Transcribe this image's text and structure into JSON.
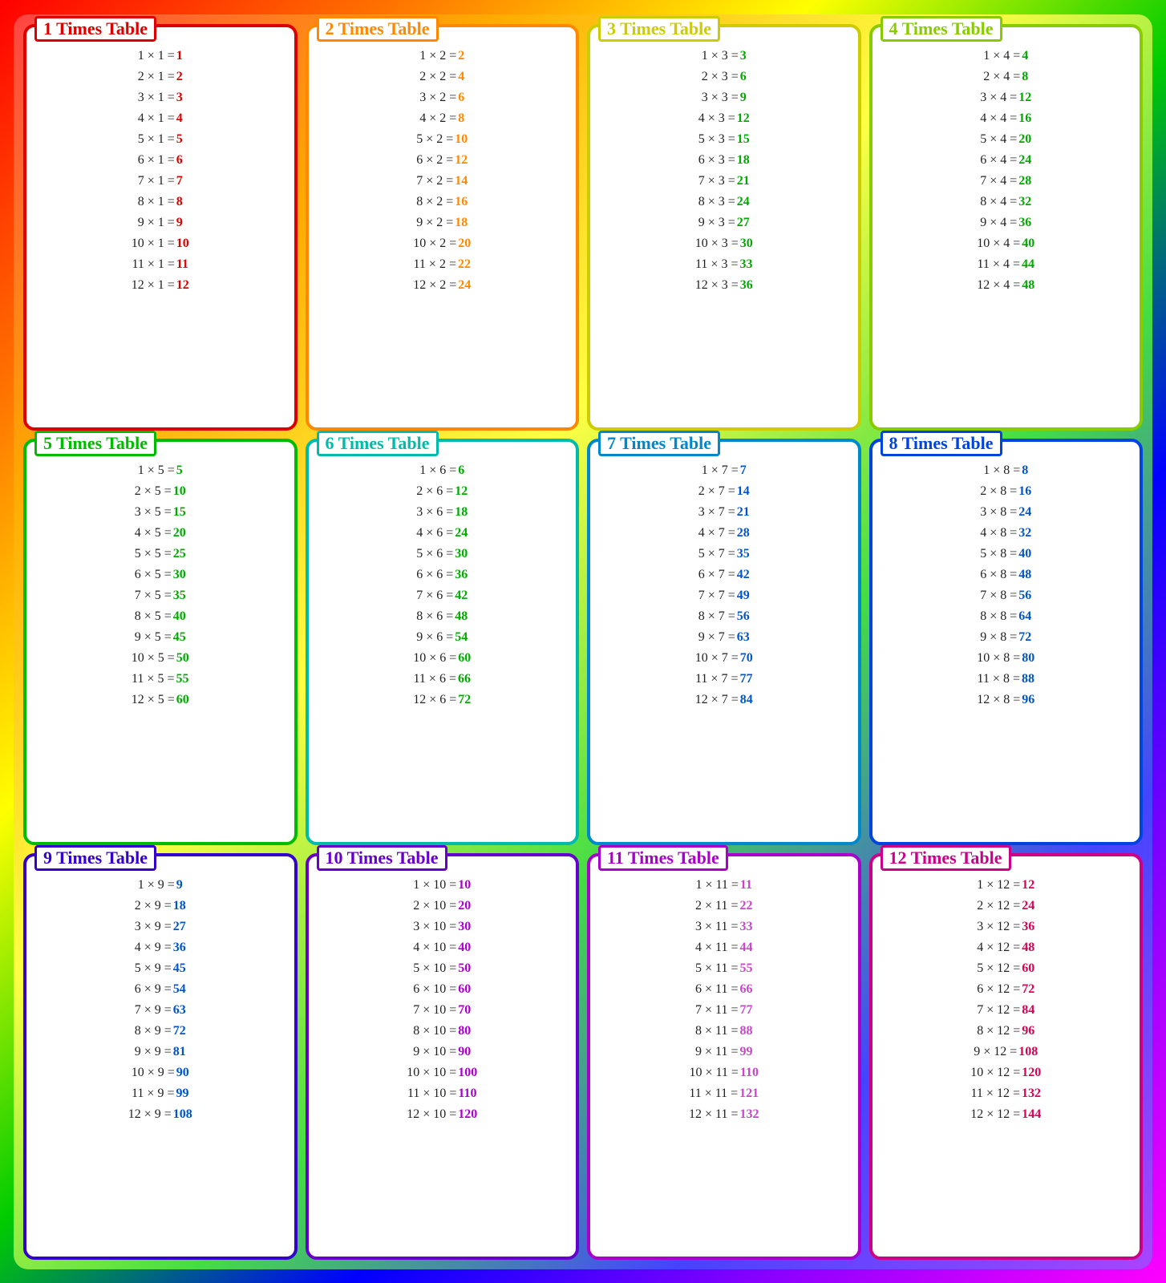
{
  "tables": [
    {
      "id": 1,
      "title": "1 Times Table",
      "multiplier": 1,
      "borderClass": "card-1",
      "resultClass": "c1",
      "rows": [
        {
          "eq": "1 × 1 = ",
          "result": "1"
        },
        {
          "eq": "2 × 1 = ",
          "result": "2"
        },
        {
          "eq": "3 × 1 = ",
          "result": "3"
        },
        {
          "eq": "4 × 1 = ",
          "result": "4"
        },
        {
          "eq": "5 × 1 = ",
          "result": "5"
        },
        {
          "eq": "6 × 1 = ",
          "result": "6"
        },
        {
          "eq": "7 × 1 = ",
          "result": "7"
        },
        {
          "eq": "8 × 1 = ",
          "result": "8"
        },
        {
          "eq": "9 × 1 = ",
          "result": "9"
        },
        {
          "eq": "10 × 1 = ",
          "result": "10"
        },
        {
          "eq": "11 × 1 = ",
          "result": "11"
        },
        {
          "eq": "12 × 1 = ",
          "result": "12"
        }
      ]
    },
    {
      "id": 2,
      "title": "2 Times Table",
      "borderClass": "card-2",
      "resultClass": "c2",
      "rows": [
        {
          "eq": "1 × 2 = ",
          "result": "2"
        },
        {
          "eq": "2 × 2 = ",
          "result": "4"
        },
        {
          "eq": "3 × 2 = ",
          "result": "6"
        },
        {
          "eq": "4 × 2 = ",
          "result": "8"
        },
        {
          "eq": "5 × 2 = ",
          "result": "10"
        },
        {
          "eq": "6 × 2 = ",
          "result": "12"
        },
        {
          "eq": "7 × 2 = ",
          "result": "14"
        },
        {
          "eq": "8 × 2 = ",
          "result": "16"
        },
        {
          "eq": "9 × 2 = ",
          "result": "18"
        },
        {
          "eq": "10 × 2 = ",
          "result": "20"
        },
        {
          "eq": "11 × 2 = ",
          "result": "22"
        },
        {
          "eq": "12 × 2 = ",
          "result": "24"
        }
      ]
    },
    {
      "id": 3,
      "title": "3 Times Table",
      "borderClass": "card-3",
      "resultClass": "c3",
      "rows": [
        {
          "eq": "1 × 3 = ",
          "result": "3"
        },
        {
          "eq": "2 × 3 = ",
          "result": "6"
        },
        {
          "eq": "3 × 3 = ",
          "result": "9"
        },
        {
          "eq": "4 × 3 = ",
          "result": "12"
        },
        {
          "eq": "5 × 3 = ",
          "result": "15"
        },
        {
          "eq": "6 × 3 = ",
          "result": "18"
        },
        {
          "eq": "7 × 3 = ",
          "result": "21"
        },
        {
          "eq": "8 × 3 = ",
          "result": "24"
        },
        {
          "eq": "9 × 3 = ",
          "result": "27"
        },
        {
          "eq": "10 × 3 = ",
          "result": "30"
        },
        {
          "eq": "11 × 3 = ",
          "result": "33"
        },
        {
          "eq": "12 × 3 = ",
          "result": "36"
        }
      ]
    },
    {
      "id": 4,
      "title": "4 Times Table",
      "borderClass": "card-4",
      "resultClass": "c4",
      "rows": [
        {
          "eq": "1 × 4 = ",
          "result": "4"
        },
        {
          "eq": "2 × 4 = ",
          "result": "8"
        },
        {
          "eq": "3 × 4 = ",
          "result": "12"
        },
        {
          "eq": "4 × 4 = ",
          "result": "16"
        },
        {
          "eq": "5 × 4 = ",
          "result": "20"
        },
        {
          "eq": "6 × 4 = ",
          "result": "24"
        },
        {
          "eq": "7 × 4 = ",
          "result": "28"
        },
        {
          "eq": "8 × 4 = ",
          "result": "32"
        },
        {
          "eq": "9 × 4 = ",
          "result": "36"
        },
        {
          "eq": "10 × 4 = ",
          "result": "40"
        },
        {
          "eq": "11 × 4 = ",
          "result": "44"
        },
        {
          "eq": "12 × 4 = ",
          "result": "48"
        }
      ]
    },
    {
      "id": 5,
      "title": "5 Times Table",
      "borderClass": "card-5",
      "resultClass": "c5",
      "rows": [
        {
          "eq": "1 × 5 = ",
          "result": "5"
        },
        {
          "eq": "2 × 5 = ",
          "result": "10"
        },
        {
          "eq": "3 × 5 = ",
          "result": "15"
        },
        {
          "eq": "4 × 5 = ",
          "result": "20"
        },
        {
          "eq": "5 × 5 = ",
          "result": "25"
        },
        {
          "eq": "6 × 5 = ",
          "result": "30"
        },
        {
          "eq": "7 × 5 = ",
          "result": "35"
        },
        {
          "eq": "8 × 5 = ",
          "result": "40"
        },
        {
          "eq": "9 × 5 = ",
          "result": "45"
        },
        {
          "eq": "10 × 5 = ",
          "result": "50"
        },
        {
          "eq": "11 × 5 = ",
          "result": "55"
        },
        {
          "eq": "12 × 5 = ",
          "result": "60"
        }
      ]
    },
    {
      "id": 6,
      "title": "6 Times Table",
      "borderClass": "card-6",
      "resultClass": "c6",
      "rows": [
        {
          "eq": "1 × 6 = ",
          "result": "6"
        },
        {
          "eq": "2 × 6 = ",
          "result": "12"
        },
        {
          "eq": "3 × 6 = ",
          "result": "18"
        },
        {
          "eq": "4 × 6 = ",
          "result": "24"
        },
        {
          "eq": "5 × 6 = ",
          "result": "30"
        },
        {
          "eq": "6 × 6 = ",
          "result": "36"
        },
        {
          "eq": "7 × 6 = ",
          "result": "42"
        },
        {
          "eq": "8 × 6 = ",
          "result": "48"
        },
        {
          "eq": "9 × 6 = ",
          "result": "54"
        },
        {
          "eq": "10 × 6 = ",
          "result": "60"
        },
        {
          "eq": "11 × 6 = ",
          "result": "66"
        },
        {
          "eq": "12 × 6 = ",
          "result": "72"
        }
      ]
    },
    {
      "id": 7,
      "title": "7 Times Table",
      "borderClass": "card-7",
      "resultClass": "c7",
      "rows": [
        {
          "eq": "1 × 7 = ",
          "result": "7"
        },
        {
          "eq": "2 × 7 = ",
          "result": "14"
        },
        {
          "eq": "3 × 7 = ",
          "result": "21"
        },
        {
          "eq": "4 × 7 = ",
          "result": "28"
        },
        {
          "eq": "5 × 7 = ",
          "result": "35"
        },
        {
          "eq": "6 × 7 = ",
          "result": "42"
        },
        {
          "eq": "7 × 7 = ",
          "result": "49"
        },
        {
          "eq": "8 × 7 = ",
          "result": "56"
        },
        {
          "eq": "9 × 7 = ",
          "result": "63"
        },
        {
          "eq": "10 × 7 = ",
          "result": "70"
        },
        {
          "eq": "11 × 7 = ",
          "result": "77"
        },
        {
          "eq": "12 × 7 = ",
          "result": "84"
        }
      ]
    },
    {
      "id": 8,
      "title": "8 Times Table",
      "borderClass": "card-8",
      "resultClass": "c8",
      "rows": [
        {
          "eq": "1 × 8 = ",
          "result": "8"
        },
        {
          "eq": "2 × 8 = ",
          "result": "16"
        },
        {
          "eq": "3 × 8 = ",
          "result": "24"
        },
        {
          "eq": "4 × 8 = ",
          "result": "32"
        },
        {
          "eq": "5 × 8 = ",
          "result": "40"
        },
        {
          "eq": "6 × 8 = ",
          "result": "48"
        },
        {
          "eq": "7 × 8 = ",
          "result": "56"
        },
        {
          "eq": "8 × 8 = ",
          "result": "64"
        },
        {
          "eq": "9 × 8 = ",
          "result": "72"
        },
        {
          "eq": "10 × 8 = ",
          "result": "80"
        },
        {
          "eq": "11 × 8 = ",
          "result": "88"
        },
        {
          "eq": "12 × 8 = ",
          "result": "96"
        }
      ]
    },
    {
      "id": 9,
      "title": "9 Times Table",
      "borderClass": "card-9",
      "resultClass": "c9",
      "rows": [
        {
          "eq": "1 × 9 = ",
          "result": "9"
        },
        {
          "eq": "2 × 9 = ",
          "result": "18"
        },
        {
          "eq": "3 × 9 = ",
          "result": "27"
        },
        {
          "eq": "4 × 9 = ",
          "result": "36"
        },
        {
          "eq": "5 × 9 = ",
          "result": "45"
        },
        {
          "eq": "6 × 9 = ",
          "result": "54"
        },
        {
          "eq": "7 × 9 = ",
          "result": "63"
        },
        {
          "eq": "8 × 9 = ",
          "result": "72"
        },
        {
          "eq": "9 × 9 = ",
          "result": "81"
        },
        {
          "eq": "10 × 9 = ",
          "result": "90"
        },
        {
          "eq": "11 × 9 = ",
          "result": "99"
        },
        {
          "eq": "12 × 9 = ",
          "result": "108"
        }
      ]
    },
    {
      "id": 10,
      "title": "10 Times Table",
      "borderClass": "card-10",
      "resultClass": "c10",
      "rows": [
        {
          "eq": "1 × 10 = ",
          "result": "10"
        },
        {
          "eq": "2 × 10 = ",
          "result": "20"
        },
        {
          "eq": "3 × 10 = ",
          "result": "30"
        },
        {
          "eq": "4 × 10 = ",
          "result": "40"
        },
        {
          "eq": "5 × 10 = ",
          "result": "50"
        },
        {
          "eq": "6 × 10 = ",
          "result": "60"
        },
        {
          "eq": "7 × 10 = ",
          "result": "70"
        },
        {
          "eq": "8 × 10 = ",
          "result": "80"
        },
        {
          "eq": "9 × 10 = ",
          "result": "90"
        },
        {
          "eq": "10 × 10 = ",
          "result": "100"
        },
        {
          "eq": "11 × 10 = ",
          "result": "110"
        },
        {
          "eq": "12 × 10 = ",
          "result": "120"
        }
      ]
    },
    {
      "id": 11,
      "title": "11 Times Table",
      "borderClass": "card-11",
      "resultClass": "c11",
      "rows": [
        {
          "eq": "1 × 11 = ",
          "result": "11"
        },
        {
          "eq": "2 × 11 = ",
          "result": "22"
        },
        {
          "eq": "3 × 11 = ",
          "result": "33"
        },
        {
          "eq": "4 × 11 = ",
          "result": "44"
        },
        {
          "eq": "5 × 11 = ",
          "result": "55"
        },
        {
          "eq": "6 × 11 = ",
          "result": "66"
        },
        {
          "eq": "7 × 11 = ",
          "result": "77"
        },
        {
          "eq": "8 × 11 = ",
          "result": "88"
        },
        {
          "eq": "9 × 11 = ",
          "result": "99"
        },
        {
          "eq": "10 × 11 = ",
          "result": "110"
        },
        {
          "eq": "11 × 11 = ",
          "result": "121"
        },
        {
          "eq": "12 × 11 = ",
          "result": "132"
        }
      ]
    },
    {
      "id": 12,
      "title": "12 Times Table",
      "borderClass": "card-12",
      "resultClass": "c12",
      "rows": [
        {
          "eq": "1 × 12 = ",
          "result": "12"
        },
        {
          "eq": "2 × 12 = ",
          "result": "24"
        },
        {
          "eq": "3 × 12 = ",
          "result": "36"
        },
        {
          "eq": "4 × 12 = ",
          "result": "48"
        },
        {
          "eq": "5 × 12 = ",
          "result": "60"
        },
        {
          "eq": "6 × 12 = ",
          "result": "72"
        },
        {
          "eq": "7 × 12 = ",
          "result": "84"
        },
        {
          "eq": "8 × 12 = ",
          "result": "96"
        },
        {
          "eq": "9 × 12 = ",
          "result": "108"
        },
        {
          "eq": "10 × 12 = ",
          "result": "120"
        },
        {
          "eq": "11 × 12 = ",
          "result": "132"
        },
        {
          "eq": "12 × 12 = ",
          "result": "144"
        }
      ]
    }
  ]
}
